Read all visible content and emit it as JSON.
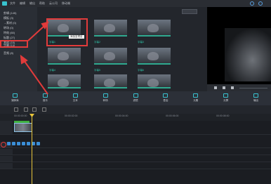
{
  "menu": [
    "文件",
    "编辑",
    "输出",
    "帮助",
    "云公司",
    "移动端"
  ],
  "sidebar": {
    "items": [
      {
        "label": "剪辑 (145)"
      },
      {
        "label": "模板 (3)"
      },
      {
        "label": "→素材 (0)"
      },
      {
        "label": "转场 (0)"
      },
      {
        "label": "特效 (60)"
      },
      {
        "label": "标题 (27)"
      },
      {
        "label": "其他 (15)"
      },
      {
        "label": "字幕 (13)"
      },
      {
        "label": "音频 (8)"
      }
    ]
  },
  "grid": {
    "search_placeholder": "搜索",
    "tooltip": "添加至项目",
    "thumb_labels": [
      "字幕1",
      "字幕2",
      "字幕3",
      "字幕4",
      "字幕5",
      "字幕6",
      "字幕7",
      "字幕8",
      "字幕9"
    ]
  },
  "tabs": [
    {
      "label": "媒体库",
      "icon": "folder-icon"
    },
    {
      "label": "音乐",
      "icon": "music-icon"
    },
    {
      "label": "文本",
      "icon": "text-icon"
    },
    {
      "label": "转场",
      "icon": "transition-icon"
    },
    {
      "label": "滤镜",
      "icon": "filter-icon"
    },
    {
      "label": "叠加",
      "icon": "overlay-icon"
    },
    {
      "label": "元素",
      "icon": "element-icon"
    },
    {
      "label": "分屏",
      "icon": "split-screen-icon"
    },
    {
      "label": "输出",
      "icon": "export-icon"
    }
  ],
  "ruler": [
    "00:00:00:00",
    "00:00:02:00",
    "00:00:04:00",
    "00:00:06:00",
    "00:00:08:00"
  ],
  "colors": {
    "accent": "#38c3cf",
    "highlight": "#e23b3b",
    "playhead": "#e8c53a"
  }
}
